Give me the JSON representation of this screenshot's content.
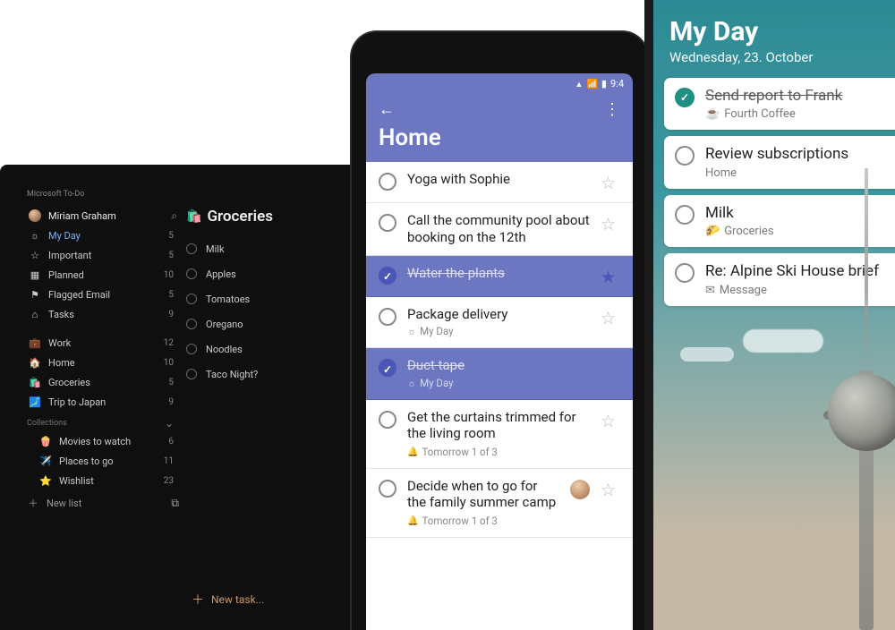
{
  "tablet": {
    "app_name": "Microsoft To-Do",
    "user_name": "Miriam Graham",
    "smart_lists": [
      {
        "icon": "☼",
        "label": "My Day",
        "count": 5,
        "active": true
      },
      {
        "icon": "☆",
        "label": "Important",
        "count": 5
      },
      {
        "icon": "▦",
        "label": "Planned",
        "count": 10
      },
      {
        "icon": "⚑",
        "label": "Flagged Email",
        "count": 5
      },
      {
        "icon": "⌂",
        "label": "Tasks",
        "count": 9
      }
    ],
    "user_lists": [
      {
        "icon": "💼",
        "label": "Work",
        "count": 12
      },
      {
        "icon": "🏠",
        "label": "Home",
        "count": 10
      },
      {
        "icon": "🛍️",
        "label": "Groceries",
        "count": 5,
        "selected": true
      },
      {
        "icon": "🗾",
        "label": "Trip to Japan",
        "count": 9
      }
    ],
    "collections_label": "Collections",
    "collections": [
      {
        "icon": "🍿",
        "label": "Movies to watch",
        "count": 6
      },
      {
        "icon": "✈️",
        "label": "Places to go",
        "count": 11
      },
      {
        "icon": "⭐",
        "label": "Wishlist",
        "count": 23
      }
    ],
    "new_list_label": "New list",
    "content": {
      "title": "Groceries",
      "items": [
        "Milk",
        "Apples",
        "Tomatoes",
        "Oregano",
        "Noodles",
        "Taco Night?"
      ],
      "new_task_label": "New task..."
    }
  },
  "phone": {
    "status_time": "9:4",
    "title": "Home",
    "tasks": [
      {
        "title": "Yoga with Sophie",
        "starred": false
      },
      {
        "title": "Call the community pool about booking on the 12th",
        "starred": false
      },
      {
        "title": "Water the plants",
        "done": true,
        "star_filled": true
      },
      {
        "title": "Package delivery",
        "sub_icon": "sun",
        "sub": "My Day",
        "starred": false
      },
      {
        "title": "Duct tape",
        "done": true,
        "sub_icon": "sun",
        "sub": "My Day"
      },
      {
        "title": "Get the curtains trimmed for the living room",
        "sub_icon": "bell",
        "sub": "Tomorrow  1 of 3",
        "starred": false
      },
      {
        "title": "Decide when to go for the family summer camp",
        "sub_icon": "bell",
        "sub": "Tomorrow  1 of 3",
        "avatar": true,
        "starred": false
      }
    ]
  },
  "ios": {
    "title": "My Day",
    "date": "Wednesday, 23. October",
    "cards": [
      {
        "title": "Send report to Frank",
        "done": true,
        "sub_icon": "coffee",
        "sub": "Fourth Coffee"
      },
      {
        "title": "Review subscriptions",
        "sub": "Home"
      },
      {
        "title": "Milk",
        "sub_icon": "taco",
        "sub": "Groceries"
      },
      {
        "title": "Re: Alpine Ski House brief",
        "sub_icon": "mail",
        "sub": "Message"
      }
    ]
  }
}
